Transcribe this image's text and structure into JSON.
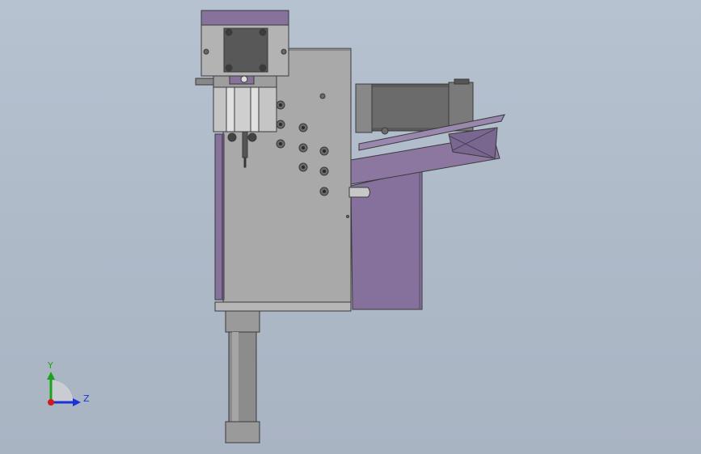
{
  "viewport": {
    "background_top": "#b7c2d1",
    "background_bottom": "#a9b4c3"
  },
  "triad": {
    "y_label": "Y",
    "z_label": "Z",
    "y_color": "#1aa31a",
    "z_color": "#1a33d6",
    "x_color": "#d21a1a"
  },
  "model": {
    "plate_color": "#a7a7a7",
    "purple_color": "#87739a",
    "dark_color": "#4a4a4a"
  }
}
